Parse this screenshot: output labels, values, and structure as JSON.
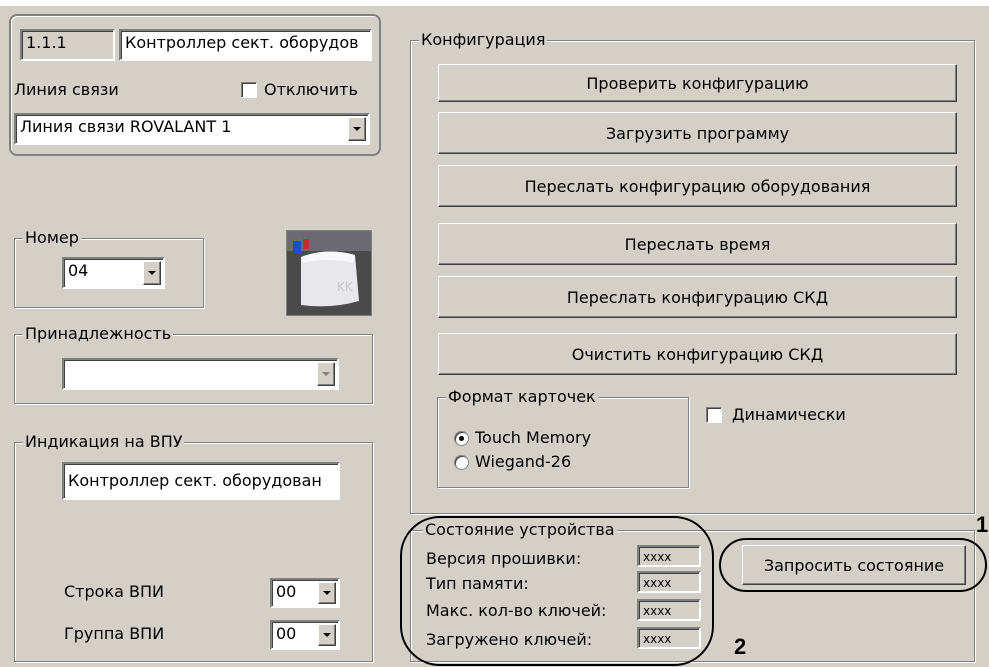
{
  "left": {
    "id_field": "1.1.1",
    "name_field": "Контроллер сект. оборудов",
    "line_label": "Линия связи",
    "disable_label": "Отключить",
    "line_select": "Линия связи ROVALANT 1",
    "number_group": "Номер",
    "number_value": "04",
    "belonging_group": "Принадлежность",
    "belonging_value": "",
    "indication_group": "Индикация на ВПУ",
    "indication_value": "Контроллер сект. оборудован",
    "vpi_row_label": "Строка ВПИ",
    "vpi_row_value": "00",
    "vpi_group_label": "Группа ВПИ",
    "vpi_group_value": "00"
  },
  "config": {
    "group": "Конфигурация",
    "buttons": [
      "Проверить конфигурацию",
      "Загрузить программу",
      "Переслать конфигурацию оборудования",
      "Переслать время",
      "Переслать конфигурацию СКД",
      "Очистить конфигурацию СКД"
    ],
    "card_format_group": "Формат карточек",
    "card_formats": [
      "Touch Memory",
      "Wiegand-26"
    ],
    "card_format_selected": "Touch Memory",
    "dynamic_label": "Динамически"
  },
  "status": {
    "group": "Состояние устройства",
    "rows": [
      {
        "label": "Версия прошивки:",
        "value": "xxxx"
      },
      {
        "label": "Тип памяти:",
        "value": "xxxx"
      },
      {
        "label": "Макс. кол-во ключей:",
        "value": "xxxx"
      },
      {
        "label": "Загружено ключей:",
        "value": "xxxx"
      }
    ],
    "request_button": "Запросить состояние"
  },
  "annotations": {
    "one": "1",
    "two": "2"
  },
  "colors": {
    "panel": "#d4d0c8",
    "shadow": "#808080"
  },
  "icons": {
    "device": "controller-device-icon"
  }
}
